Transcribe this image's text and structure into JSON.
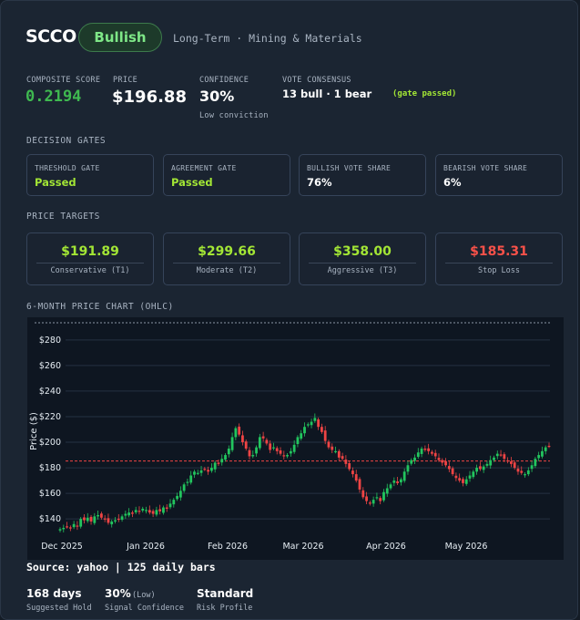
{
  "header": {
    "ticker": "SCCO",
    "signal": "Bullish",
    "subtitle": "Long-Term · Mining & Materials"
  },
  "metrics": {
    "composite_label": "COMPOSITE SCORE",
    "composite_value": "0.2194",
    "price_label": "PRICE",
    "price_value": "$196.88",
    "confidence_label": "CONFIDENCE",
    "confidence_value": "30%",
    "confidence_note": "Low conviction",
    "vote_label": "VOTE CONSENSUS",
    "vote_value": "13 bull · 1 bear",
    "vote_note": "(gate passed)"
  },
  "gates": {
    "title": "DECISION GATES",
    "items": [
      {
        "label": "THRESHOLD GATE",
        "value": "Passed",
        "color": "#a3e635"
      },
      {
        "label": "AGREEMENT GATE",
        "value": "Passed",
        "color": "#a3e635"
      },
      {
        "label": "BULLISH VOTE SHARE",
        "value": "76%",
        "color": "#ffffff"
      },
      {
        "label": "BEARISH VOTE SHARE",
        "value": "6%",
        "color": "#ffffff"
      }
    ]
  },
  "targets": {
    "title": "PRICE TARGETS",
    "items": [
      {
        "value": "$191.89",
        "label": "Conservative (T1)",
        "color": "#a3e635"
      },
      {
        "value": "$299.66",
        "label": "Moderate (T2)",
        "color": "#a3e635"
      },
      {
        "value": "$358.00",
        "label": "Aggressive (T3)",
        "color": "#a3e635"
      },
      {
        "value": "$185.31",
        "label": "Stop Loss",
        "color": "#f85149"
      }
    ]
  },
  "chart_section_title": "6-MONTH PRICE CHART (OHLC)",
  "chart_data": {
    "type": "candlestick",
    "ylabel": "Price ($)",
    "yticks": [
      140,
      160,
      180,
      200,
      220,
      240,
      260,
      280
    ],
    "ylim": [
      128,
      292
    ],
    "xticks": [
      "Dec 2025",
      "Jan 2026",
      "Feb 2026",
      "Mar 2026",
      "Apr 2026",
      "May 2026"
    ],
    "stop_loss_line": 185.31,
    "grid": true,
    "up_color": "#22c55e",
    "down_color": "#ef4444",
    "close_series": [
      132,
      133,
      134,
      133,
      136,
      134,
      140,
      139,
      141,
      138,
      142,
      143,
      141,
      140,
      137,
      138,
      139,
      140,
      142,
      144,
      145,
      144,
      147,
      146,
      148,
      147,
      145,
      144,
      147,
      146,
      149,
      148,
      152,
      155,
      158,
      162,
      167,
      169,
      174,
      177,
      176,
      178,
      179,
      177,
      180,
      184,
      183,
      187,
      190,
      195,
      204,
      211,
      206,
      200,
      195,
      189,
      190,
      196,
      204,
      203,
      199,
      194,
      196,
      193,
      191,
      189,
      190,
      193,
      198,
      204,
      207,
      212,
      214,
      216,
      219,
      212,
      208,
      201,
      196,
      194,
      193,
      188,
      187,
      183,
      179,
      175,
      170,
      163,
      157,
      154,
      152,
      155,
      157,
      154,
      161,
      164,
      167,
      170,
      168,
      171,
      177,
      182,
      186,
      188,
      192,
      195,
      194,
      193,
      191,
      189,
      186,
      184,
      182,
      179,
      175,
      172,
      170,
      168,
      171,
      174,
      177,
      180,
      179,
      181,
      183,
      186,
      188,
      191,
      190,
      187,
      185,
      183,
      180,
      177,
      176,
      175,
      178,
      182,
      187,
      190,
      193,
      196,
      197
    ]
  },
  "source": "Source: yahoo | 125 daily bars",
  "footer": {
    "hold_value": "168 days",
    "hold_label": "Suggested Hold",
    "signal_value": "30%",
    "signal_level": "(Low)",
    "signal_label": "Signal Confidence",
    "risk_value": "Standard",
    "risk_label": "Risk Profile"
  }
}
